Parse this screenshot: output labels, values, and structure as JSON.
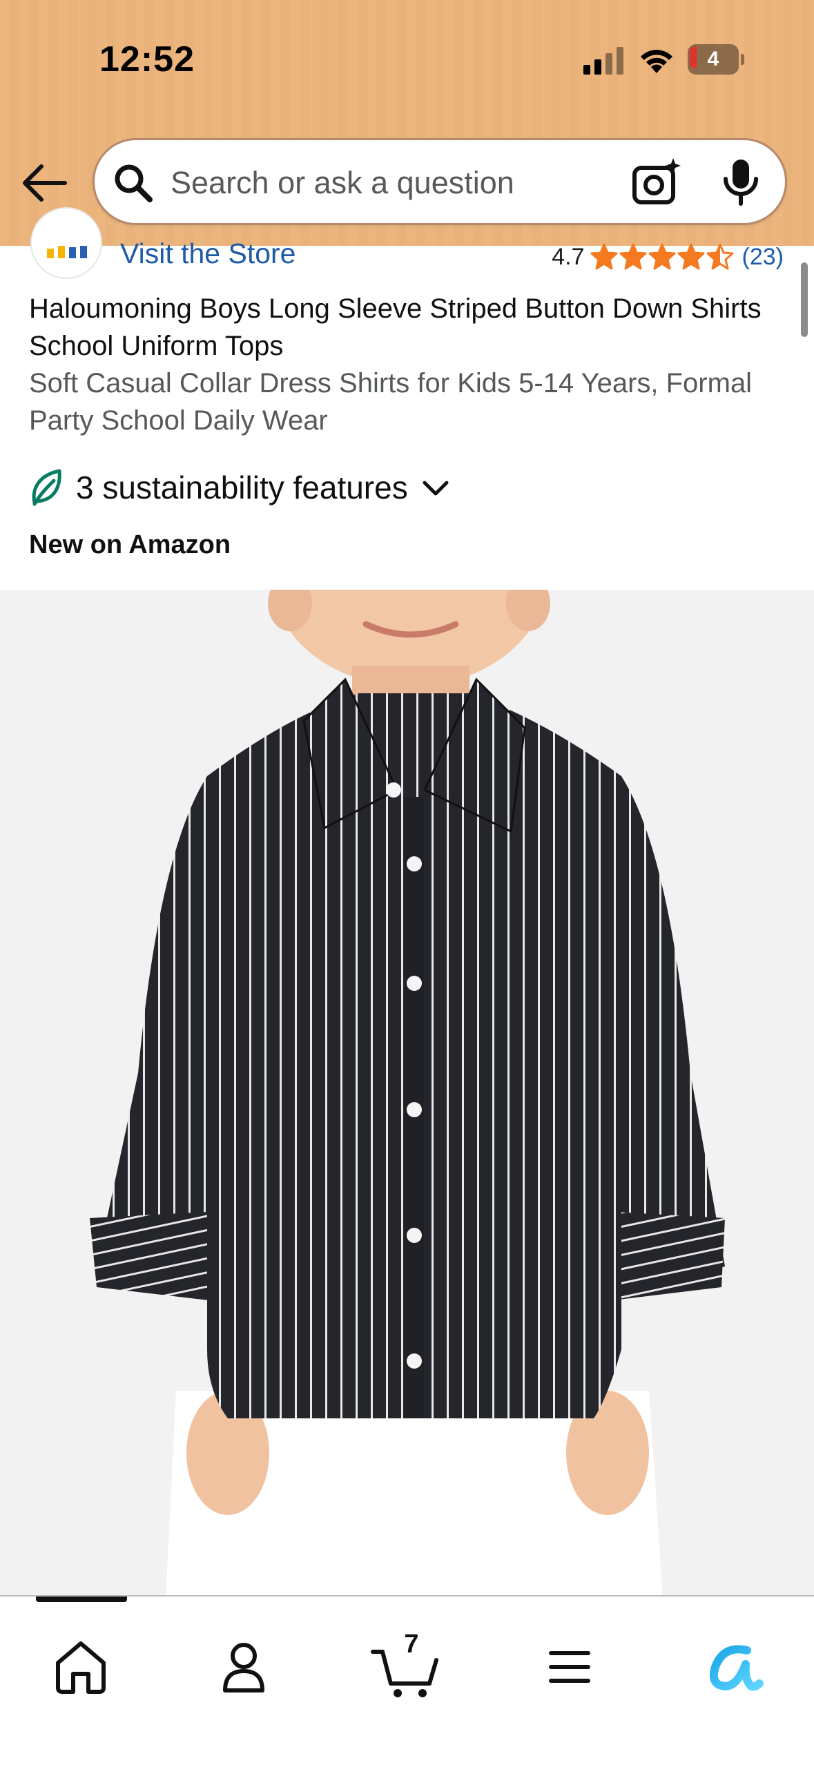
{
  "status_bar": {
    "time": "12:52",
    "battery_level": "4",
    "battery_color": "#e3312c"
  },
  "header": {
    "background_color": "#ecb57e",
    "back_icon": "arrow-left-icon",
    "search": {
      "placeholder": "Search or ask a question",
      "value": "",
      "search_icon": "magnifier-icon",
      "camera_icon": "camera-sparkle-icon",
      "mic_icon": "microphone-icon"
    }
  },
  "product": {
    "store_link": "Visit the Store",
    "rating": {
      "value": "4.7",
      "stars": 4.5,
      "count": "(23)",
      "star_color": "#f5791f"
    },
    "title": "Haloumoning Boys Long Sleeve Striped Button Down Shirts School Uniform Tops",
    "subtitle": "Soft Casual Collar Dress Shirts for Kids 5-14 Years, Formal Party School Daily Wear",
    "sustainability": {
      "label": "3 sustainability features",
      "icon": "leaf-icon",
      "leaf_color": "#067d62"
    },
    "badge": "New on Amazon",
    "image": {
      "description_icon": "product-photo",
      "background_color": "#f2f2f2"
    }
  },
  "bottom_nav": {
    "items": [
      {
        "name": "home",
        "icon": "home-icon"
      },
      {
        "name": "account",
        "icon": "person-icon"
      },
      {
        "name": "cart",
        "icon": "cart-icon",
        "count": "7"
      },
      {
        "name": "menu",
        "icon": "hamburger-menu-icon"
      },
      {
        "name": "rufus",
        "icon": "rufus-ai-icon"
      }
    ]
  }
}
